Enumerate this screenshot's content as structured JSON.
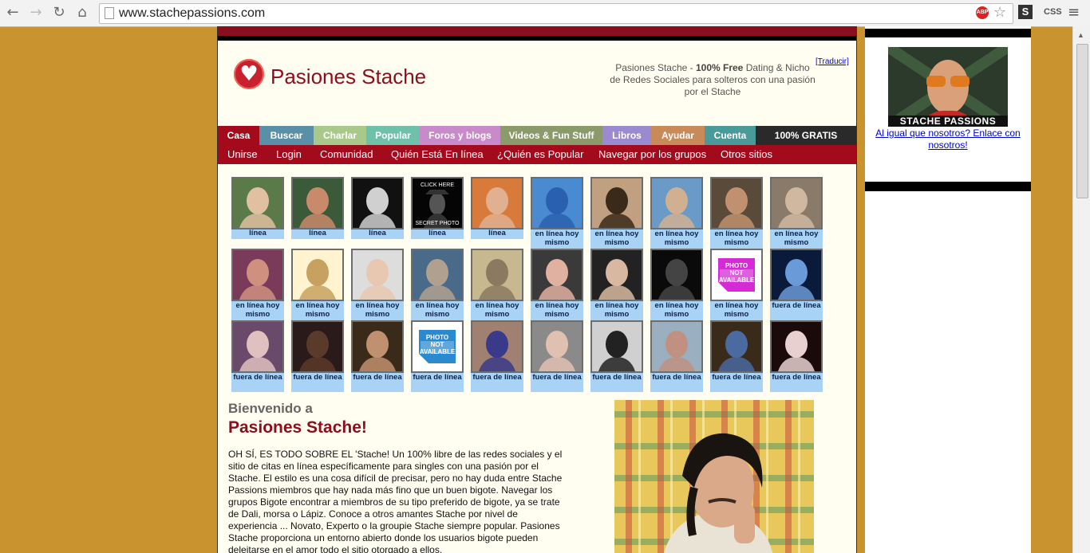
{
  "browser": {
    "url": "www.stachepassions.com",
    "ext_css_label": "CSS",
    "ext_s_label": "S",
    "abp_label": "ABP"
  },
  "header": {
    "logo_text": "Pasiones Stache",
    "tagline_pre": "Pasiones Stache - ",
    "tagline_bold": "100% Free",
    "tagline_post": " Dating & Nicho de Redes Sociales para solteros con una pasión por el Stache",
    "translate": "[Traducir]"
  },
  "tabs": [
    {
      "label": "Casa",
      "color": "#a30a1c"
    },
    {
      "label": "Buscar",
      "color": "#5a8fa8"
    },
    {
      "label": "Charlar",
      "color": "#a8c98a"
    },
    {
      "label": "Popular",
      "color": "#6fc0a8"
    },
    {
      "label": "Foros y blogs",
      "color": "#c98ac9"
    },
    {
      "label": "Videos & Fun Stuff",
      "color": "#8a9a6a"
    },
    {
      "label": "Libros",
      "color": "#9a8ad0"
    },
    {
      "label": "Ayudar",
      "color": "#c98a5a"
    },
    {
      "label": "Cuenta",
      "color": "#4a9a9a"
    },
    {
      "label": "100% GRATIS",
      "color": "#2a2a2a"
    }
  ],
  "subnav": [
    "Unirse",
    "Login",
    "Comunidad",
    "Quién Está En línea",
    "¿Quién es Popular",
    "Navegar por los grupos",
    "Otros sitios"
  ],
  "members": [
    [
      "línea",
      "línea",
      "línea",
      "línea",
      "línea",
      "en línea hoy mismo",
      "en línea hoy mismo",
      "en línea hoy mismo",
      "en línea hoy mismo",
      "en línea hoy mismo"
    ],
    [
      "en línea hoy mismo",
      "en línea hoy mismo",
      "en línea hoy mismo",
      "en línea hoy mismo",
      "en línea hoy mismo",
      "en línea hoy mismo",
      "en línea hoy mismo",
      "en línea hoy mismo",
      "en línea hoy mismo",
      "fuera de línea"
    ],
    [
      "fuera de línea",
      "fuera de línea",
      "fuera de línea",
      "fuera de línea",
      "fuera de línea",
      "fuera de línea",
      "fuera de línea",
      "fuera de línea",
      "fuera de línea",
      "fuera de línea"
    ]
  ],
  "thumb_texts": {
    "click_here": "CLICK HERE",
    "secret_photo": "SECRET PHOTO",
    "photo_na": "PHOTO NOT AVAILABLE"
  },
  "welcome": {
    "line1": "Bienvenido a",
    "line2": "Pasiones Stache!",
    "intro": "OH SÍ, ES TODO SOBRE EL 'Stache! Un 100% libre de las redes sociales y el sitio de citas en línea específicamente para singles con una pasión por el Stache. El estilo es una cosa difícil de precisar, pero no hay duda entre Stache Passions miembros que hay nada más fino que un buen bigote. Navegar los grupos Bigote encontrar a miembros de su tipo preferido de bigote, ya se trate de Dali, morsa o Lápiz. Conoce a otros amantes Stache por nivel de experiencia ... Novato, Experto o la groupie Stache siempre popular. Pasiones Stache proporciona un entorno abierto donde los usuarios bigote pueden deleitarse en el amor todo el sitio otorgado a ellos."
  },
  "sidebar": {
    "ad_label": "STACHE PASSIONS",
    "ad_link": "Al igual que nosotros? Enlace con nosotros!"
  }
}
